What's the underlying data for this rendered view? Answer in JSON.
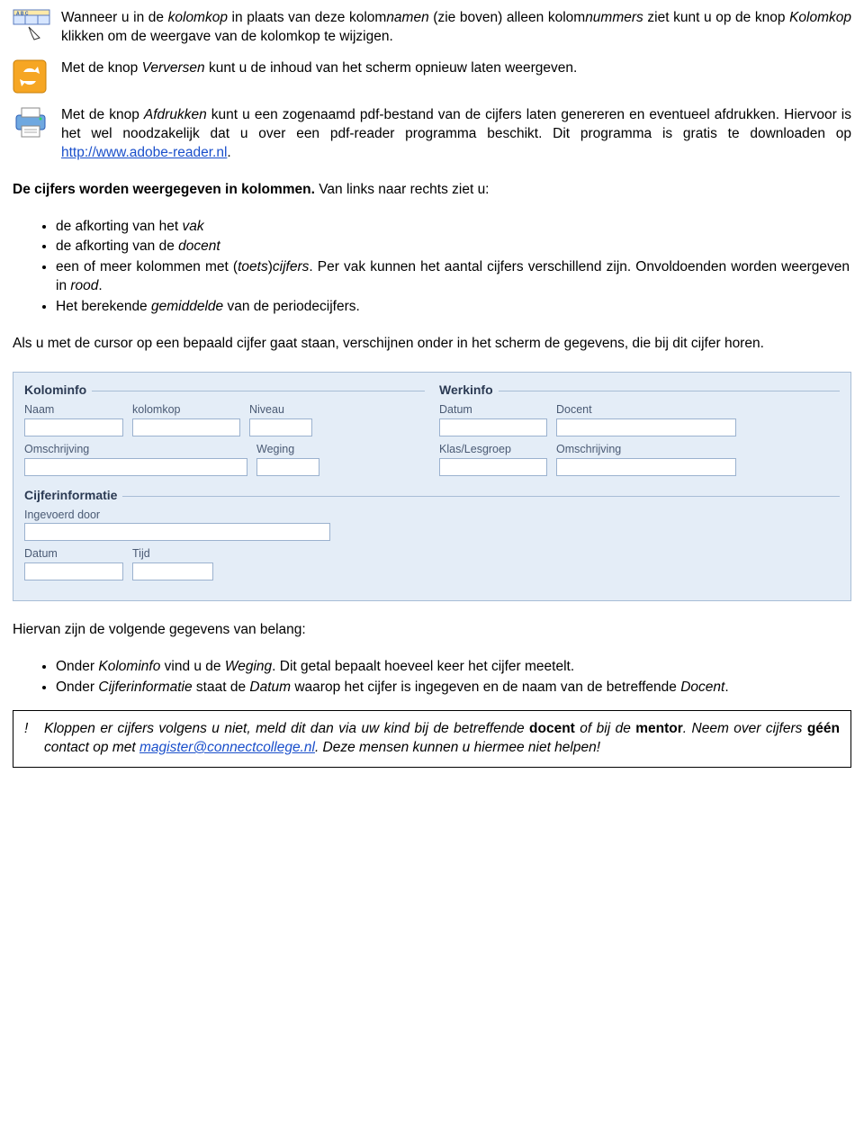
{
  "para1": {
    "a": "Wanneer u in de ",
    "b": "kolomkop",
    "c": " in plaats van deze kolom",
    "d": "namen",
    "e": " (zie boven) alleen kolom",
    "f": "nummers",
    "g": " ziet kunt u op de knop ",
    "h": "Kolomkop",
    "i": " klikken om de weergave van de kolomkop te wijzigen."
  },
  "para2": {
    "a": "Met de knop ",
    "b": "Verversen",
    "c": " kunt u de inhoud van het scherm opnieuw laten weergeven."
  },
  "para3": {
    "a": "Met de knop ",
    "b": "Afdrukken",
    "c": " kunt u een zogenaamd pdf-bestand van de cijfers laten genereren en eventueel afdrukken. Hiervoor is het wel noodzakelijk dat u over een pdf-reader programma beschikt. Dit programma is gratis te downloaden op ",
    "link": "http://www.adobe-reader.nl",
    "d": "."
  },
  "section1": {
    "lead_a": "De cijfers worden weergegeven in kolommen.",
    "lead_b": " Van links naar rechts ziet u:",
    "b1a": "de afkorting van het ",
    "b1b": "vak",
    "b2a": "de afkorting van de ",
    "b2b": "docent",
    "b3a": "een of meer kolommen met (",
    "b3b": "toets",
    "b3c": ")",
    "b3d": "cijfers",
    "b3e": ". Per vak kunnen het aantal cijfers verschillend zijn. Onvoldoenden worden weergeven in ",
    "b3f": "rood",
    "b3g": ".",
    "b4a": "Het berekende ",
    "b4b": "gemiddelde",
    "b4c": " van de periodecijfers.",
    "trail": "Als u met de cursor op een bepaald cijfer gaat staan, verschijnen onder in het scherm de gegevens, die bij dit cijfer horen."
  },
  "panel": {
    "kolominfo": "Kolominfo",
    "werkinfo": "Werkinfo",
    "cijferinfo": "Cijferinformatie",
    "naam": "Naam",
    "kolomkop": "kolomkop",
    "niveau": "Niveau",
    "datum": "Datum",
    "docent": "Docent",
    "omschrijving": "Omschrijving",
    "weging": "Weging",
    "klas": "Klas/Lesgroep",
    "ingevoerd": "Ingevoerd door",
    "tijd": "Tijd"
  },
  "section2": {
    "lead": "Hiervan zijn de volgende gegevens van belang:",
    "b1a": "Onder ",
    "b1b": "Kolominfo",
    "b1c": " vind u de ",
    "b1d": "Weging",
    "b1e": ". Dit getal bepaalt hoeveel keer het cijfer meetelt.",
    "b2a": "Onder ",
    "b2b": "Cijferinformatie",
    "b2c": " staat de ",
    "b2d": "Datum",
    "b2e": " waarop het cijfer is ingegeven en de naam van de betreffende ",
    "b2f": "Docent",
    "b2g": "."
  },
  "note": {
    "excl": "!",
    "a": "Kloppen er cijfers volgens u niet, meld dit dan via uw kind bij de betreffende ",
    "b": "docent",
    "c": " of bij de ",
    "d": "mentor",
    "e": ". Neem over cijfers ",
    "f": "géén",
    "g": " contact op met ",
    "link": "magister@connectcollege.nl",
    "h": ". Deze mensen kunnen u hiermee niet helpen!"
  }
}
